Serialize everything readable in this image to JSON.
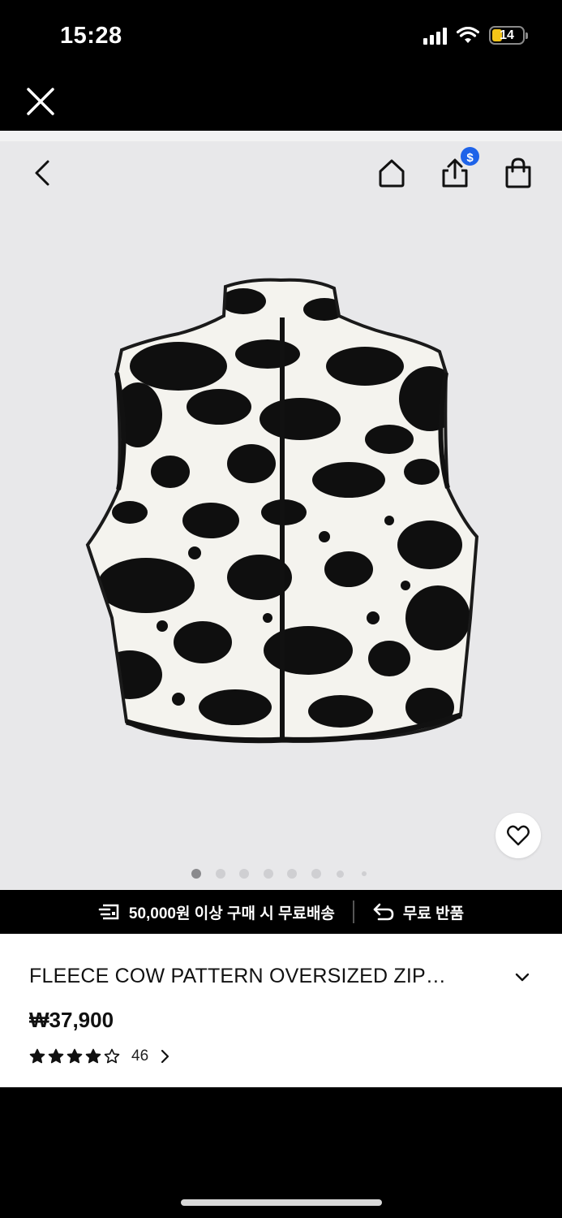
{
  "status_bar": {
    "time": "15:28",
    "battery": "14"
  },
  "webview": {
    "close_icon": "close-icon"
  },
  "nav": {
    "back_icon": "chevron-left-icon",
    "home_icon": "home-icon",
    "share_icon": "share-icon",
    "share_badge": "$",
    "bag_icon": "shopping-bag-icon"
  },
  "gallery": {
    "image_count": 8,
    "active_index": 0,
    "wishlist_icon": "heart-icon"
  },
  "shipping": {
    "free_shipping": "50,000원 이상 구매 시 무료배송",
    "free_return": "무료 반품"
  },
  "product": {
    "title": "FLEECE COW PATTERN OVERSIZED ZIP…",
    "price": "₩37,900",
    "rating": 4,
    "rating_max": 5,
    "review_count": "46"
  },
  "colors": {
    "badge": "#1e63e9",
    "background": "#e8e8ea",
    "battery": "#f5c518"
  }
}
